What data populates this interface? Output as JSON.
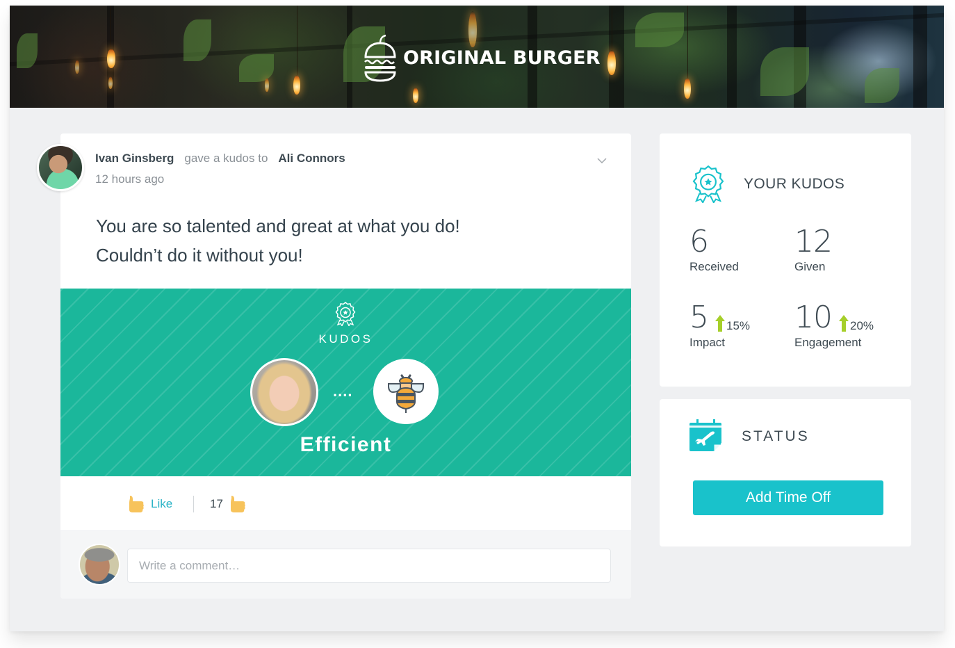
{
  "banner": {
    "brand_name": "ORIGINAL BURGER",
    "logo_icon": "burger-apple-logo-icon"
  },
  "post": {
    "author": "Ivan Ginsberg",
    "action": "gave a kudos to",
    "recipient": "Ali Connors",
    "timestamp": "12 hours ago",
    "message_line1": "You are so talented and great at what you do!",
    "message_line2": "Couldn’t do it without you!",
    "menu_icon": "chevron-down-icon",
    "kudos": {
      "label": "KUDOS",
      "icon": "award-ribbon-icon",
      "connector": "....",
      "badge_icon": "bee-icon",
      "badge_name": "Efficient",
      "background_color": "#1bb79b"
    },
    "like": {
      "label": "Like",
      "count": "17",
      "icon": "thumbs-up-icon"
    },
    "comment": {
      "placeholder": "Write a comment…",
      "value": ""
    }
  },
  "your_kudos": {
    "title": "YOUR KUDOS",
    "icon": "award-ribbon-icon",
    "stats": [
      {
        "value": "6",
        "label": "Received"
      },
      {
        "value": "12",
        "label": "Given"
      },
      {
        "value": "5",
        "label": "Impact",
        "trend": "up",
        "change": "15%"
      },
      {
        "value": "10",
        "label": "Engagement",
        "trend": "up",
        "change": "20%"
      }
    ]
  },
  "status": {
    "title": "STATUS",
    "icon": "calendar-airplane-icon",
    "button_label": "Add Time Off"
  },
  "colors": {
    "accent": "#19c2cb",
    "kudos_green": "#1bb79b",
    "trend_up": "#a6cf2a",
    "link": "#2ab3c6",
    "thumb": "#f7c35b"
  }
}
